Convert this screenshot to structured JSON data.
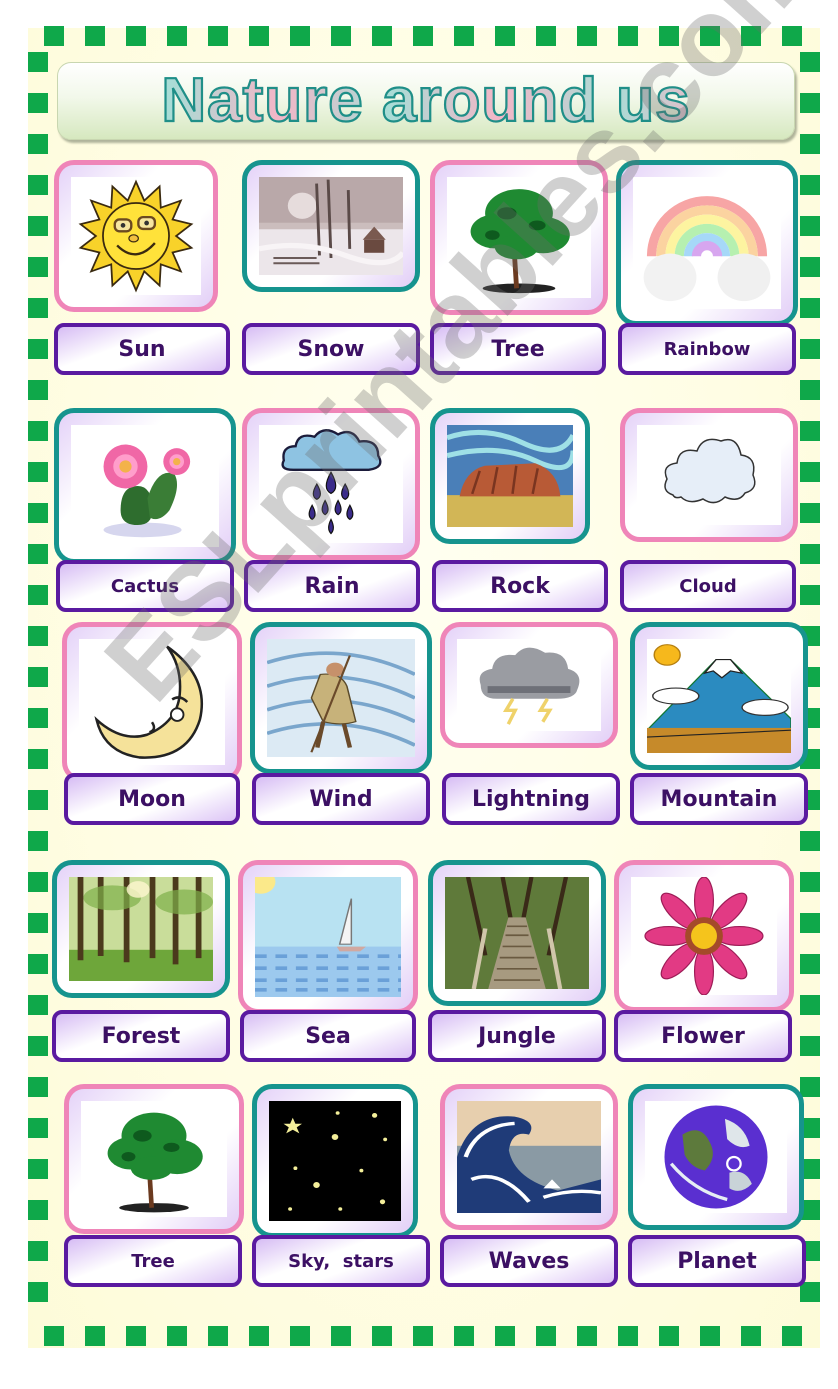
{
  "title": "Nature around us",
  "watermark": "ESLprintables.com",
  "colors": {
    "border_dots": "#0fa84a",
    "frame_pink": "#ef85b8",
    "frame_teal": "#16948e",
    "label_border": "#5a1aa0",
    "label_text": "#3c1064"
  },
  "cards": [
    {
      "label": "Sun",
      "icon": "sun-icon",
      "frame": "pink"
    },
    {
      "label": "Snow",
      "icon": "snow-scene-icon",
      "frame": "teal"
    },
    {
      "label": "Tree",
      "icon": "tree-icon",
      "frame": "pink"
    },
    {
      "label": "Rainbow",
      "icon": "rainbow-icon",
      "frame": "teal"
    },
    {
      "label": "Cactus",
      "icon": "cactus-icon",
      "frame": "teal"
    },
    {
      "label": "Rain",
      "icon": "rain-icon",
      "frame": "pink"
    },
    {
      "label": "Rock",
      "icon": "rock-icon",
      "frame": "teal"
    },
    {
      "label": "Cloud",
      "icon": "cloud-icon",
      "frame": "pink"
    },
    {
      "label": "Moon",
      "icon": "moon-icon",
      "frame": "pink"
    },
    {
      "label": "Wind",
      "icon": "wind-icon",
      "frame": "teal"
    },
    {
      "label": "Lightning",
      "icon": "lightning-icon",
      "frame": "pink"
    },
    {
      "label": "Mountain",
      "icon": "mountain-icon",
      "frame": "teal"
    },
    {
      "label": "Forest",
      "icon": "forest-icon",
      "frame": "teal"
    },
    {
      "label": "Sea",
      "icon": "sea-icon",
      "frame": "pink"
    },
    {
      "label": "Jungle",
      "icon": "jungle-icon",
      "frame": "teal"
    },
    {
      "label": "Flower",
      "icon": "flower-icon",
      "frame": "pink"
    },
    {
      "label": "Tree",
      "icon": "tree-icon",
      "frame": "pink"
    },
    {
      "label": "Sky,  stars",
      "icon": "night-sky-stars-icon",
      "frame": "teal"
    },
    {
      "label": "Waves",
      "icon": "waves-icon",
      "frame": "pink"
    },
    {
      "label": "Planet",
      "icon": "planet-icon",
      "frame": "teal"
    }
  ]
}
